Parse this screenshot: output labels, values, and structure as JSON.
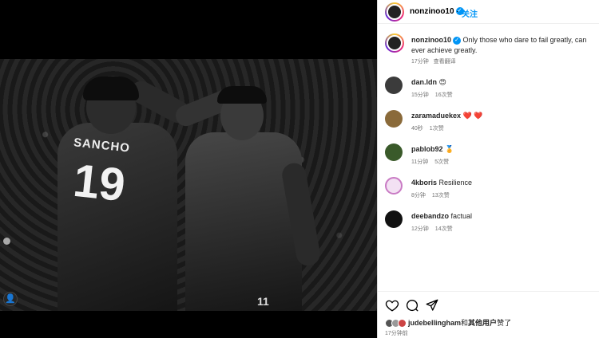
{
  "header": {
    "username": "nonzinoo10",
    "separator": "·",
    "follow_label": "关注"
  },
  "post": {
    "caption_username": "nonzinoo10",
    "caption_text": "Only those who dare to fail greatly, can ever achieve greatly.",
    "caption_time": "17分钟",
    "translate_label": "查看翻译",
    "jersey_name": "SANCHO",
    "jersey_number": "19",
    "jersey_number_2": "11"
  },
  "comments": [
    {
      "username": "dan.ldn",
      "text": "😍",
      "time": "15分钟",
      "likes": "16次赞",
      "avatar_color": "#3b3b3b"
    },
    {
      "username": "zaramaduekex",
      "text": "❤️ ❤️",
      "time": "40秒",
      "likes": "1次赞",
      "avatar_color": "#8a6a3a"
    },
    {
      "username": "pablob92",
      "text": "🏅",
      "time": "11分钟",
      "likes": "5次赞",
      "avatar_color": "#3a5a2a"
    },
    {
      "username": "4kboris",
      "text": "Resilience",
      "time": "8分钟",
      "likes": "13次赞",
      "avatar_color": "#e7c3e6"
    },
    {
      "username": "deebandzo",
      "text": "factual",
      "time": "12分钟",
      "likes": "14次赞",
      "avatar_color": "#111111"
    }
  ],
  "liked_by": {
    "user": "judebellingham",
    "connector": "和",
    "others": "其他用户",
    "suffix": "赞了"
  },
  "footer_time": "17分钟前",
  "colors": {
    "accent": "#0095f6",
    "heart": "#e0245e"
  }
}
